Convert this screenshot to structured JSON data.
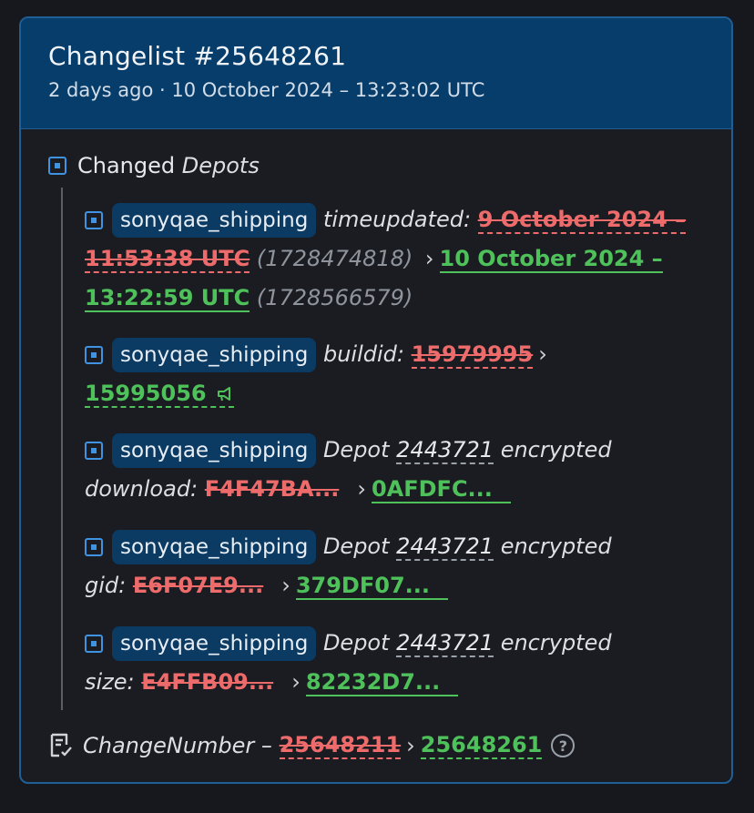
{
  "header": {
    "title": "Changelist #25648261",
    "subtitle": "2 days ago · 10 October 2024 – 13:23:02 UTC"
  },
  "section": {
    "label_plain": "Changed ",
    "label_italic": "Depots"
  },
  "entries": [
    {
      "app": "sonyqae_shipping",
      "key": "timeupdated:",
      "old_value": "9 October 2024 – 11:53:38 UTC",
      "old_raw": "(1728474818)",
      "new_value": "10 October 2024 – 13:22:59 UTC",
      "new_raw": "(1728566579)"
    },
    {
      "app": "sonyqae_shipping",
      "key": "buildid:",
      "old_value": "15979995",
      "new_value": "15995056"
    },
    {
      "app": "sonyqae_shipping",
      "prefix": "Depot",
      "depot": "2443721",
      "suffix": "encrypted",
      "key": "download:",
      "old_value": "F4F47BA...",
      "new_value": "0AFDFC..."
    },
    {
      "app": "sonyqae_shipping",
      "prefix": "Depot",
      "depot": "2443721",
      "suffix": "encrypted",
      "key": "gid:",
      "old_value": "E6F07E9...",
      "new_value": "379DF07..."
    },
    {
      "app": "sonyqae_shipping",
      "prefix": "Depot",
      "depot": "2443721",
      "suffix": "encrypted",
      "key": "size:",
      "old_value": "E4FFB09...",
      "new_value": "82232D7..."
    }
  ],
  "footer": {
    "label": "ChangeNumber –",
    "old_value": "25648211",
    "new_value": "25648261"
  },
  "arrow": "›",
  "help": "?",
  "colors": {
    "header_bg": "#063d6a",
    "border": "#1f5f96",
    "removed": "#ee6b6b",
    "added": "#4ec15a",
    "badge_bg": "#0b3a63",
    "icon_blue": "#3f93e0"
  }
}
